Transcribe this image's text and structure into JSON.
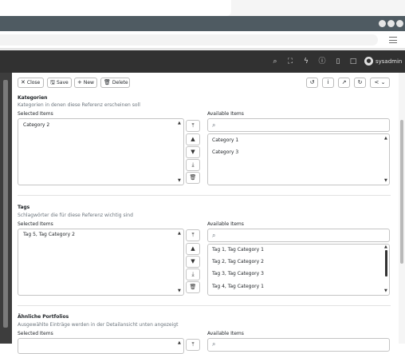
{
  "app": {
    "user": "sysadmin",
    "top_icons": [
      "search-icon",
      "fullscreen-icon",
      "flash-icon",
      "info-icon",
      "bookmark-icon",
      "file-icon"
    ]
  },
  "toolbar": {
    "close_label": "Close",
    "save_label": "Save",
    "new_label": "New",
    "delete_label": "Delete"
  },
  "sections": [
    {
      "title": "Kategorien",
      "description": "Kategorien in denen diese Referenz erscheinen soll",
      "selected_label": "Selected Items",
      "available_label": "Available Items",
      "selected_value": "Category 2",
      "available_items": [
        "Category 1",
        "Category 3"
      ]
    },
    {
      "title": "Tags",
      "description": "Schlagwörter die für diese Referenz wichtig sind",
      "selected_label": "Selected Items",
      "available_label": "Available Items",
      "selected_value": "Tag 5, Tag Category 2",
      "available_items": [
        "Tag 1, Tag Category 1",
        "Tag 2, Tag Category 2",
        "Tag 3, Tag Category 3",
        "Tag 4, Tag Category 1"
      ]
    },
    {
      "title": "Ähnliche Portfolios",
      "description": "Ausgewählte Einträge werden in der Detailansicht unten angezeigt",
      "selected_label": "Selected Items",
      "available_label": "Available Items"
    }
  ],
  "colors": {
    "titlebar": "#4f5b62",
    "app_header": "#313131",
    "left_strip": "#3d3d3d"
  }
}
